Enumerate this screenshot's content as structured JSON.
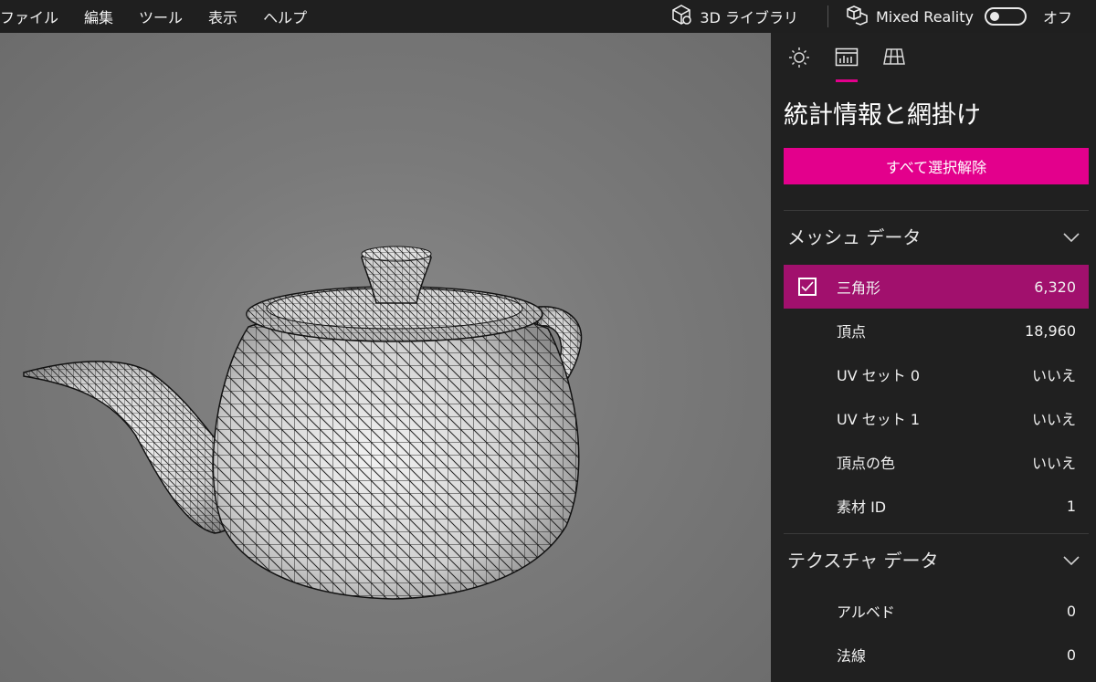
{
  "menu": {
    "items": [
      "ファイル",
      "編集",
      "ツール",
      "表示",
      "ヘルプ"
    ]
  },
  "toolbar": {
    "library_label": "3D ライブラリ",
    "library_icon": "cube-icon",
    "mixed_reality_label": "Mixed Reality",
    "mixed_reality_icon": "mixed-reality-icon",
    "toggle_state_label": "オフ"
  },
  "panel": {
    "tabs": [
      {
        "icon": "sun-icon",
        "active": false
      },
      {
        "icon": "stats-icon",
        "active": true
      },
      {
        "icon": "grid-icon",
        "active": false
      }
    ],
    "title": "統計情報と網掛け",
    "deselect_label": "すべて選択解除",
    "accent_color": "#e3008c",
    "mesh_section": {
      "title": "メッシュ データ",
      "rows": [
        {
          "label": "三角形",
          "value": "6,320",
          "selected": true
        },
        {
          "label": "頂点",
          "value": "18,960"
        },
        {
          "label": "UV セット 0",
          "value": "いいえ"
        },
        {
          "label": "UV セット 1",
          "value": "いいえ"
        },
        {
          "label": "頂点の色",
          "value": "いいえ"
        },
        {
          "label": "素材 ID",
          "value": "1"
        }
      ]
    },
    "texture_section": {
      "title": "テクスチャ データ",
      "rows": [
        {
          "label": "アルベド",
          "value": "0"
        },
        {
          "label": "法線",
          "value": "0"
        }
      ]
    }
  }
}
